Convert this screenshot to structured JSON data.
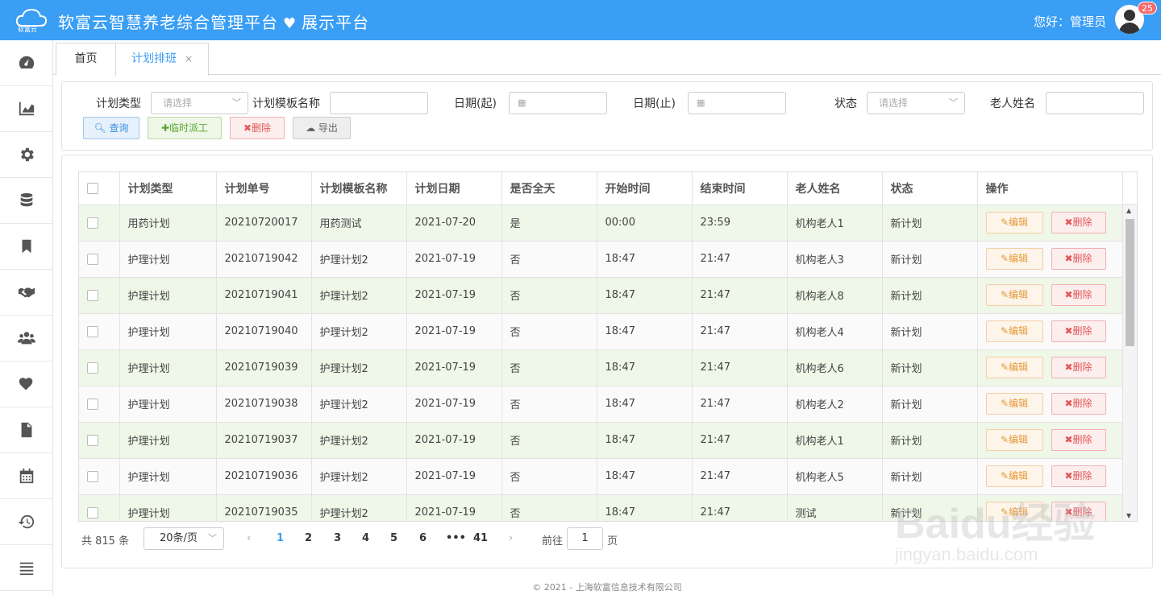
{
  "header": {
    "logo_text": "软富云",
    "title": "软富云智慧养老综合管理平台",
    "subtitle": "展示平台",
    "greeting": "您好：管理员",
    "badge_count": "25"
  },
  "sidebar": {
    "icons": [
      "dashboard-icon",
      "chart-icon",
      "gear-icon",
      "database-icon",
      "bookmark-icon",
      "handshake-icon",
      "users-icon",
      "heart-icon",
      "document-icon",
      "calendar-icon",
      "history-icon",
      "menu-icon"
    ]
  },
  "tabs": [
    {
      "label": "首页"
    },
    {
      "label": "计划排班",
      "close": "×"
    }
  ],
  "filters": {
    "plan_type_label": "计划类型",
    "plan_type_placeholder": "请选择",
    "template_label": "计划模板名称",
    "template_value": "",
    "date_start_label": "日期(起)",
    "date_end_label": "日期(止)",
    "status_label": "状态",
    "status_placeholder": "请选择",
    "elder_name_label": "老人姓名",
    "elder_name_value": ""
  },
  "toolbar": {
    "query_label": "查询",
    "dispatch_label": "临时派工",
    "delete_label": "删除",
    "export_label": "导出"
  },
  "table": {
    "columns": [
      "计划类型",
      "计划单号",
      "计划模板名称",
      "计划日期",
      "是否全天",
      "开始时间",
      "结束时间",
      "老人姓名",
      "状态",
      "操作"
    ],
    "edit_label": "编辑",
    "delete_label": "删除",
    "rows": [
      {
        "type": "用药计划",
        "no": "20210720017",
        "template": "用药测试",
        "date": "2021-07-20",
        "allday": "是",
        "start": "00:00",
        "end": "23:59",
        "elder": "机构老人1",
        "status": "新计划"
      },
      {
        "type": "护理计划",
        "no": "20210719042",
        "template": "护理计划2",
        "date": "2021-07-19",
        "allday": "否",
        "start": "18:47",
        "end": "21:47",
        "elder": "机构老人3",
        "status": "新计划"
      },
      {
        "type": "护理计划",
        "no": "20210719041",
        "template": "护理计划2",
        "date": "2021-07-19",
        "allday": "否",
        "start": "18:47",
        "end": "21:47",
        "elder": "机构老人8",
        "status": "新计划"
      },
      {
        "type": "护理计划",
        "no": "20210719040",
        "template": "护理计划2",
        "date": "2021-07-19",
        "allday": "否",
        "start": "18:47",
        "end": "21:47",
        "elder": "机构老人4",
        "status": "新计划"
      },
      {
        "type": "护理计划",
        "no": "20210719039",
        "template": "护理计划2",
        "date": "2021-07-19",
        "allday": "否",
        "start": "18:47",
        "end": "21:47",
        "elder": "机构老人6",
        "status": "新计划"
      },
      {
        "type": "护理计划",
        "no": "20210719038",
        "template": "护理计划2",
        "date": "2021-07-19",
        "allday": "否",
        "start": "18:47",
        "end": "21:47",
        "elder": "机构老人2",
        "status": "新计划"
      },
      {
        "type": "护理计划",
        "no": "20210719037",
        "template": "护理计划2",
        "date": "2021-07-19",
        "allday": "否",
        "start": "18:47",
        "end": "21:47",
        "elder": "机构老人1",
        "status": "新计划"
      },
      {
        "type": "护理计划",
        "no": "20210719036",
        "template": "护理计划2",
        "date": "2021-07-19",
        "allday": "否",
        "start": "18:47",
        "end": "21:47",
        "elder": "机构老人5",
        "status": "新计划"
      },
      {
        "type": "护理计划",
        "no": "20210719035",
        "template": "护理计划2",
        "date": "2021-07-19",
        "allday": "否",
        "start": "18:47",
        "end": "21:47",
        "elder": "测试",
        "status": "新计划"
      }
    ]
  },
  "pagination": {
    "total_text": "共 815 条",
    "page_size": "20条/页",
    "pages": [
      "1",
      "2",
      "3",
      "4",
      "5",
      "6",
      "•••",
      "41"
    ],
    "current_page": "1",
    "goto_prefix": "前往",
    "goto_value": "1",
    "goto_suffix": "页"
  },
  "footer": {
    "copyright": "© 2021 - 上海软富信息技术有限公司"
  },
  "watermark": {
    "line1": "Baidu经验",
    "line2": "jingyan.baidu.com"
  },
  "colors": {
    "primary": "#3a9ef5",
    "row_highlight": "#eef7e8",
    "danger": "#e25757",
    "warning": "#e69a3a",
    "success": "#5aa830"
  }
}
